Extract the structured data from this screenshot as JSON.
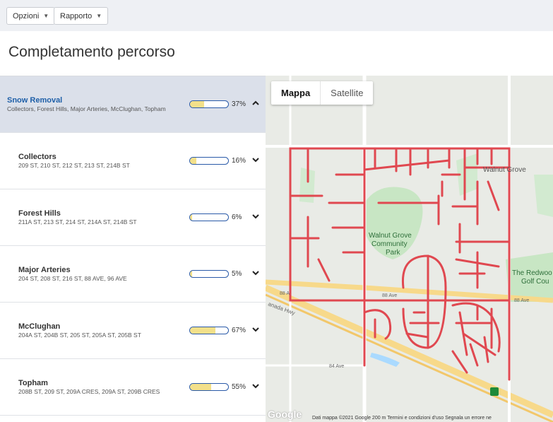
{
  "toolbar": {
    "options_label": "Opzioni",
    "report_label": "Rapporto"
  },
  "page_title": "Completamento percorso",
  "routes": [
    {
      "name": "Snow Removal",
      "streets": "Collectors, Forest Hills, Major Arteries, McClughan, Topham",
      "percent": 37,
      "percent_label": "37%",
      "expanded": true
    },
    {
      "name": "Collectors",
      "streets": "209 ST, 210 ST, 212 ST, 213 ST, 214B ST",
      "percent": 16,
      "percent_label": "16%"
    },
    {
      "name": "Forest Hills",
      "streets": "211A ST, 213 ST, 214 ST, 214A ST, 214B ST",
      "percent": 6,
      "percent_label": "6%"
    },
    {
      "name": "Major Arteries",
      "streets": "204 ST, 208 ST, 216 ST, 88 AVE, 96 AVE",
      "percent": 5,
      "percent_label": "5%"
    },
    {
      "name": "McClughan",
      "streets": "204A ST, 204B ST, 205 ST, 205A ST, 205B ST",
      "percent": 67,
      "percent_label": "67%"
    },
    {
      "name": "Topham",
      "streets": "208B ST, 209 ST, 209A CRES, 209A ST, 209B CRES",
      "percent": 55,
      "percent_label": "55%"
    }
  ],
  "map": {
    "tab_map": "Mappa",
    "tab_satellite": "Satellite",
    "labels": {
      "walnut_grove": "Walnut Grove",
      "park_1": "Walnut Grove",
      "park_2": "Community",
      "park_3": "Park",
      "redwood_1": "The Redwoo",
      "redwood_2": "Golf Cou",
      "ave88_a": "88 A",
      "ave88_b": "88 Ave",
      "ave88_c": "88 Ave",
      "ave84": "84 Ave",
      "hwy": "anada Hwy"
    },
    "google": "Google",
    "attribution": "Dati mappa ©2021 Google     200 m            Termini e condizioni d'uso     Segnala un errore ne",
    "route_color": "#e04850"
  }
}
